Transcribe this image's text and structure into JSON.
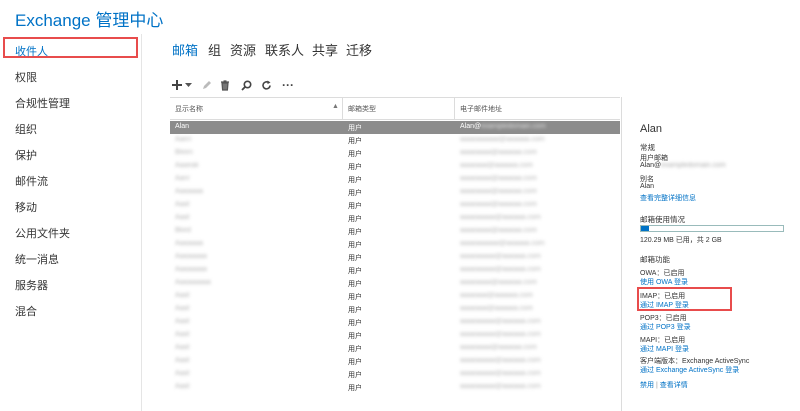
{
  "app": {
    "title": "Exchange 管理中心"
  },
  "sidebar": {
    "items": [
      {
        "label": "收件人"
      },
      {
        "label": "权限"
      },
      {
        "label": "合规性管理"
      },
      {
        "label": "组织"
      },
      {
        "label": "保护"
      },
      {
        "label": "邮件流"
      },
      {
        "label": "移动"
      },
      {
        "label": "公用文件夹"
      },
      {
        "label": "统一消息"
      },
      {
        "label": "服务器"
      },
      {
        "label": "混合"
      }
    ]
  },
  "tabs": [
    {
      "label": "邮箱"
    },
    {
      "label": "组"
    },
    {
      "label": "资源"
    },
    {
      "label": "联系人"
    },
    {
      "label": "共享"
    },
    {
      "label": "迁移"
    }
  ],
  "toolbar": {
    "add_icon": "plus-icon",
    "dropdown_icon": "chevron-down-icon",
    "edit_icon": "pencil-icon",
    "delete_icon": "trash-icon",
    "search_icon": "search-icon",
    "refresh_icon": "refresh-icon",
    "more_label": "···"
  },
  "table": {
    "columns": [
      "显示名称",
      "邮箱类型",
      "电子邮件地址"
    ],
    "rows": [
      {
        "name": "Alan",
        "type": "用户",
        "email": "Alan@",
        "email_blur": "exampledomain.com"
      },
      {
        "name": "Aaen",
        "type": "用户",
        "email": "",
        "email_blur": "aaaaaaaaaa@aaaaaa.com"
      },
      {
        "name": "Bleen",
        "type": "用户",
        "email": "",
        "email_blur": "aaaaaaaa@aaaaaa.com"
      },
      {
        "name": "Aaaeak",
        "type": "用户",
        "email": "",
        "email_blur": "aaaaaaa@aaaaaa.com"
      },
      {
        "name": "Aanr",
        "type": "用户",
        "email": "",
        "email_blur": "aaaaaaaa@aaaaaa.com"
      },
      {
        "name": "Aaaaaaa",
        "type": "用户",
        "email": "",
        "email_blur": "aaaaaaaa@aaaaaa.com"
      },
      {
        "name": "Aaat",
        "type": "用户",
        "email": "",
        "email_blur": "aaaaaaaa@aaaaaa.com"
      },
      {
        "name": "Aaat",
        "type": "用户",
        "email": "",
        "email_blur": "aaaaaaaaa@aaaaaa.com"
      },
      {
        "name": "Bked",
        "type": "用户",
        "email": "",
        "email_blur": "aaaaaaaa@aaaaaa.com"
      },
      {
        "name": "Aaaaaaa",
        "type": "用户",
        "email": "",
        "email_blur": "aaaaaaaaaa@aaaaaa.com"
      },
      {
        "name": "Aaaaaaaa",
        "type": "用户",
        "email": "",
        "email_blur": "aaaaaaaaa@aaaaaa.com"
      },
      {
        "name": "Aaaaaaaa",
        "type": "用户",
        "email": "",
        "email_blur": "aaaaaaaaa@aaaaaa.com"
      },
      {
        "name": "Aaaaaaaaa",
        "type": "用户",
        "email": "",
        "email_blur": "aaaaaaaa@aaaaaa.com"
      },
      {
        "name": "Aaat",
        "type": "用户",
        "email": "",
        "email_blur": "aaaaaaa@aaaaaa.com"
      },
      {
        "name": "Aaat",
        "type": "用户",
        "email": "",
        "email_blur": "aaaaaaa@aaaaaa.com"
      },
      {
        "name": "Aaat",
        "type": "用户",
        "email": "",
        "email_blur": "aaaaaaaaa@aaaaaa.com"
      },
      {
        "name": "Aaat",
        "type": "用户",
        "email": "",
        "email_blur": "aaaaaaaaa@aaaaaa.com"
      },
      {
        "name": "Aaat",
        "type": "用户",
        "email": "",
        "email_blur": "aaaaaaaa@aaaaaa.com"
      },
      {
        "name": "Aaat",
        "type": "用户",
        "email": "",
        "email_blur": "aaaaaaaaa@aaaaaa.com"
      },
      {
        "name": "Aaat",
        "type": "用户",
        "email": "",
        "email_blur": "aaaaaaaaa@aaaaaa.com"
      },
      {
        "name": "Aaat",
        "type": "用户",
        "email": "",
        "email_blur": "aaaaaaaaa@aaaaaa.com"
      }
    ]
  },
  "details": {
    "name": "Alan",
    "general_heading": "常规",
    "general_type": "用户邮箱",
    "general_email": "Alan@",
    "general_email_blur": "exampledomain.com",
    "alias_label": "别名",
    "alias_value": "Alan",
    "view_details_link": "查看完整详细信息",
    "usage_heading": "邮箱使用情况",
    "usage_fraction": 0.059,
    "usage_text": "120.29 MB 已用，共 2 GB",
    "features_heading": "邮箱功能",
    "owa_status": "OWA：已启用",
    "owa_link": "使用 OWA 登录",
    "imap_status": "IMAP：已启用",
    "imap_link": "通过 IMAP 登录",
    "pop3_status": "POP3：已启用",
    "pop3_link": "通过 POP3 登录",
    "mapi_status": "MAPI：已启用",
    "mapi_link": "通过 MAPI 登录",
    "client_status": "客户端版本：Exchange ActiveSync",
    "client_link": "通过 Exchange ActiveSync 登录",
    "disable_link": "禁用",
    "more_link": "查看详情"
  },
  "colors": {
    "accent": "#0072c6",
    "highlight": "#e84c4c",
    "selected_row": "#8c8c8c"
  }
}
